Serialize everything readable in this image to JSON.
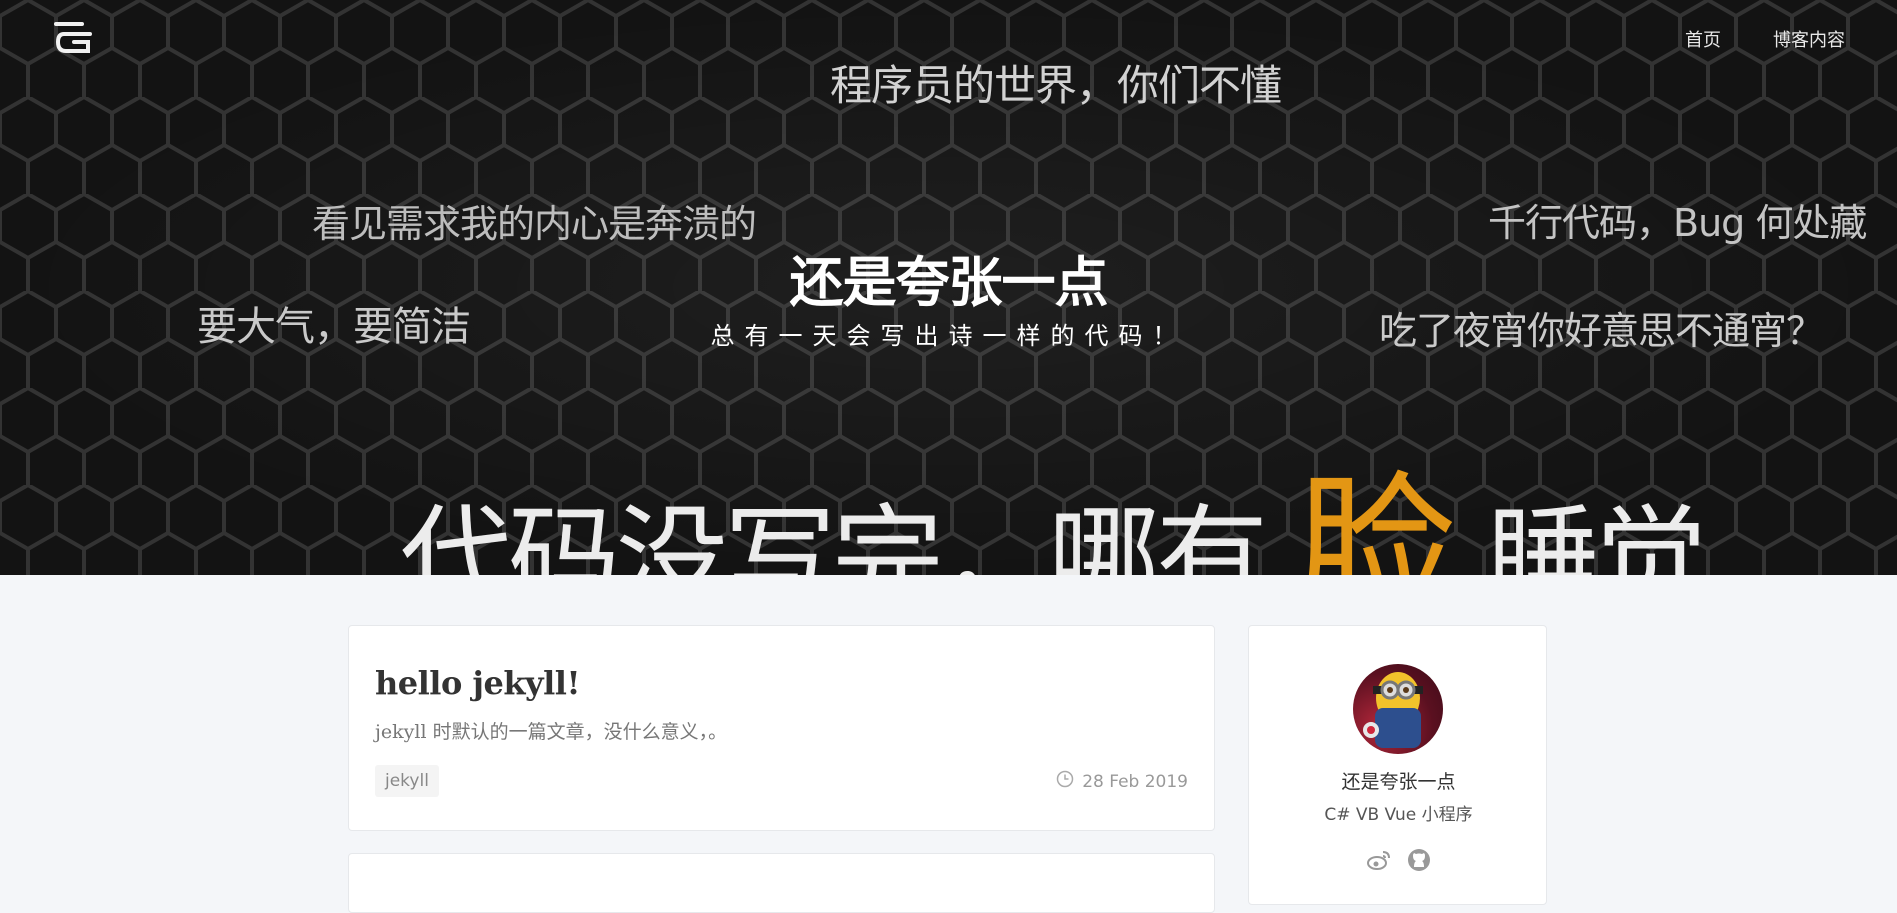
{
  "nav": {
    "items": [
      "首页",
      "博客内容"
    ]
  },
  "logo": {
    "icon": "logo-icon"
  },
  "hero": {
    "title": "还是夸张一点",
    "subtitle": "总有一天会写出诗一样的代码！",
    "slogans": [
      "程序员的世界，你们不懂",
      "看见需求我的内心是奔溃的",
      "千行代码，Bug 何处藏",
      "要大气，要简洁",
      "吃了夜宵你好意思不通宵？"
    ],
    "big_slogan": {
      "before": "代码没写完，哪有",
      "highlight": "脸",
      "after": "睡觉"
    },
    "highlight_color": "#e39614"
  },
  "post": {
    "title": "hello jekyll!",
    "excerpt": "jekyll 时默认的一篇文章，没什么意义，。",
    "tag": "jekyll",
    "date": "28 Feb 2019",
    "date_icon": "clock-icon"
  },
  "sidebar": {
    "name": "还是夸张一点",
    "bio": "C# VB Vue 小程序",
    "social": [
      "weibo-icon",
      "github-icon"
    ]
  }
}
